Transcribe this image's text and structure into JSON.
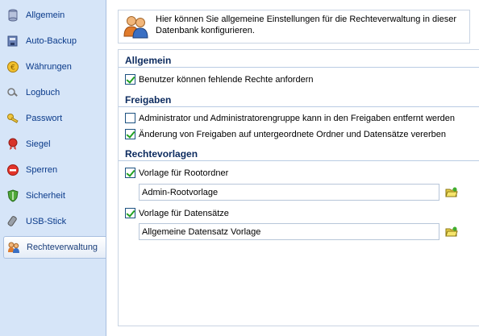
{
  "sidebar": {
    "items": [
      {
        "label": "Allgemein",
        "icon": "database-icon"
      },
      {
        "label": "Auto-Backup",
        "icon": "backup-icon"
      },
      {
        "label": "Währungen",
        "icon": "coin-icon"
      },
      {
        "label": "Logbuch",
        "icon": "logbook-icon"
      },
      {
        "label": "Passwort",
        "icon": "key-icon"
      },
      {
        "label": "Siegel",
        "icon": "seal-icon"
      },
      {
        "label": "Sperren",
        "icon": "stop-icon"
      },
      {
        "label": "Sicherheit",
        "icon": "shield-icon"
      },
      {
        "label": "USB-Stick",
        "icon": "usb-icon"
      },
      {
        "label": "Rechteverwaltung",
        "icon": "users-icon"
      }
    ],
    "active_index": 9
  },
  "header": {
    "description": "Hier können Sie allgemeine Einstellungen für die Rechteverwaltung in dieser Datenbank konfigurieren."
  },
  "sections": {
    "allgemein": {
      "title": "Allgemein",
      "option1": {
        "label": "Benutzer können fehlende Rechte anfordern",
        "checked": true
      }
    },
    "freigaben": {
      "title": "Freigaben",
      "option1": {
        "label": "Administrator und Administratorengruppe kann in den Freigaben entfernt werden",
        "checked": false
      },
      "option2": {
        "label": "Änderung von Freigaben auf untergeordnete Ordner und Datensätze vererben",
        "checked": true
      }
    },
    "rechtevorlagen": {
      "title": "Rechtevorlagen",
      "root": {
        "label": "Vorlage für Rootordner",
        "checked": true,
        "value": "Admin-Rootvorlage"
      },
      "records": {
        "label": "Vorlage für Datensätze",
        "checked": true,
        "value": "Allgemeine Datensatz Vorlage"
      }
    }
  },
  "colors": {
    "sidebar_bg": "#d6e5f8",
    "section_title": "#0b2a5e",
    "nav_text": "#0a3a8a"
  }
}
